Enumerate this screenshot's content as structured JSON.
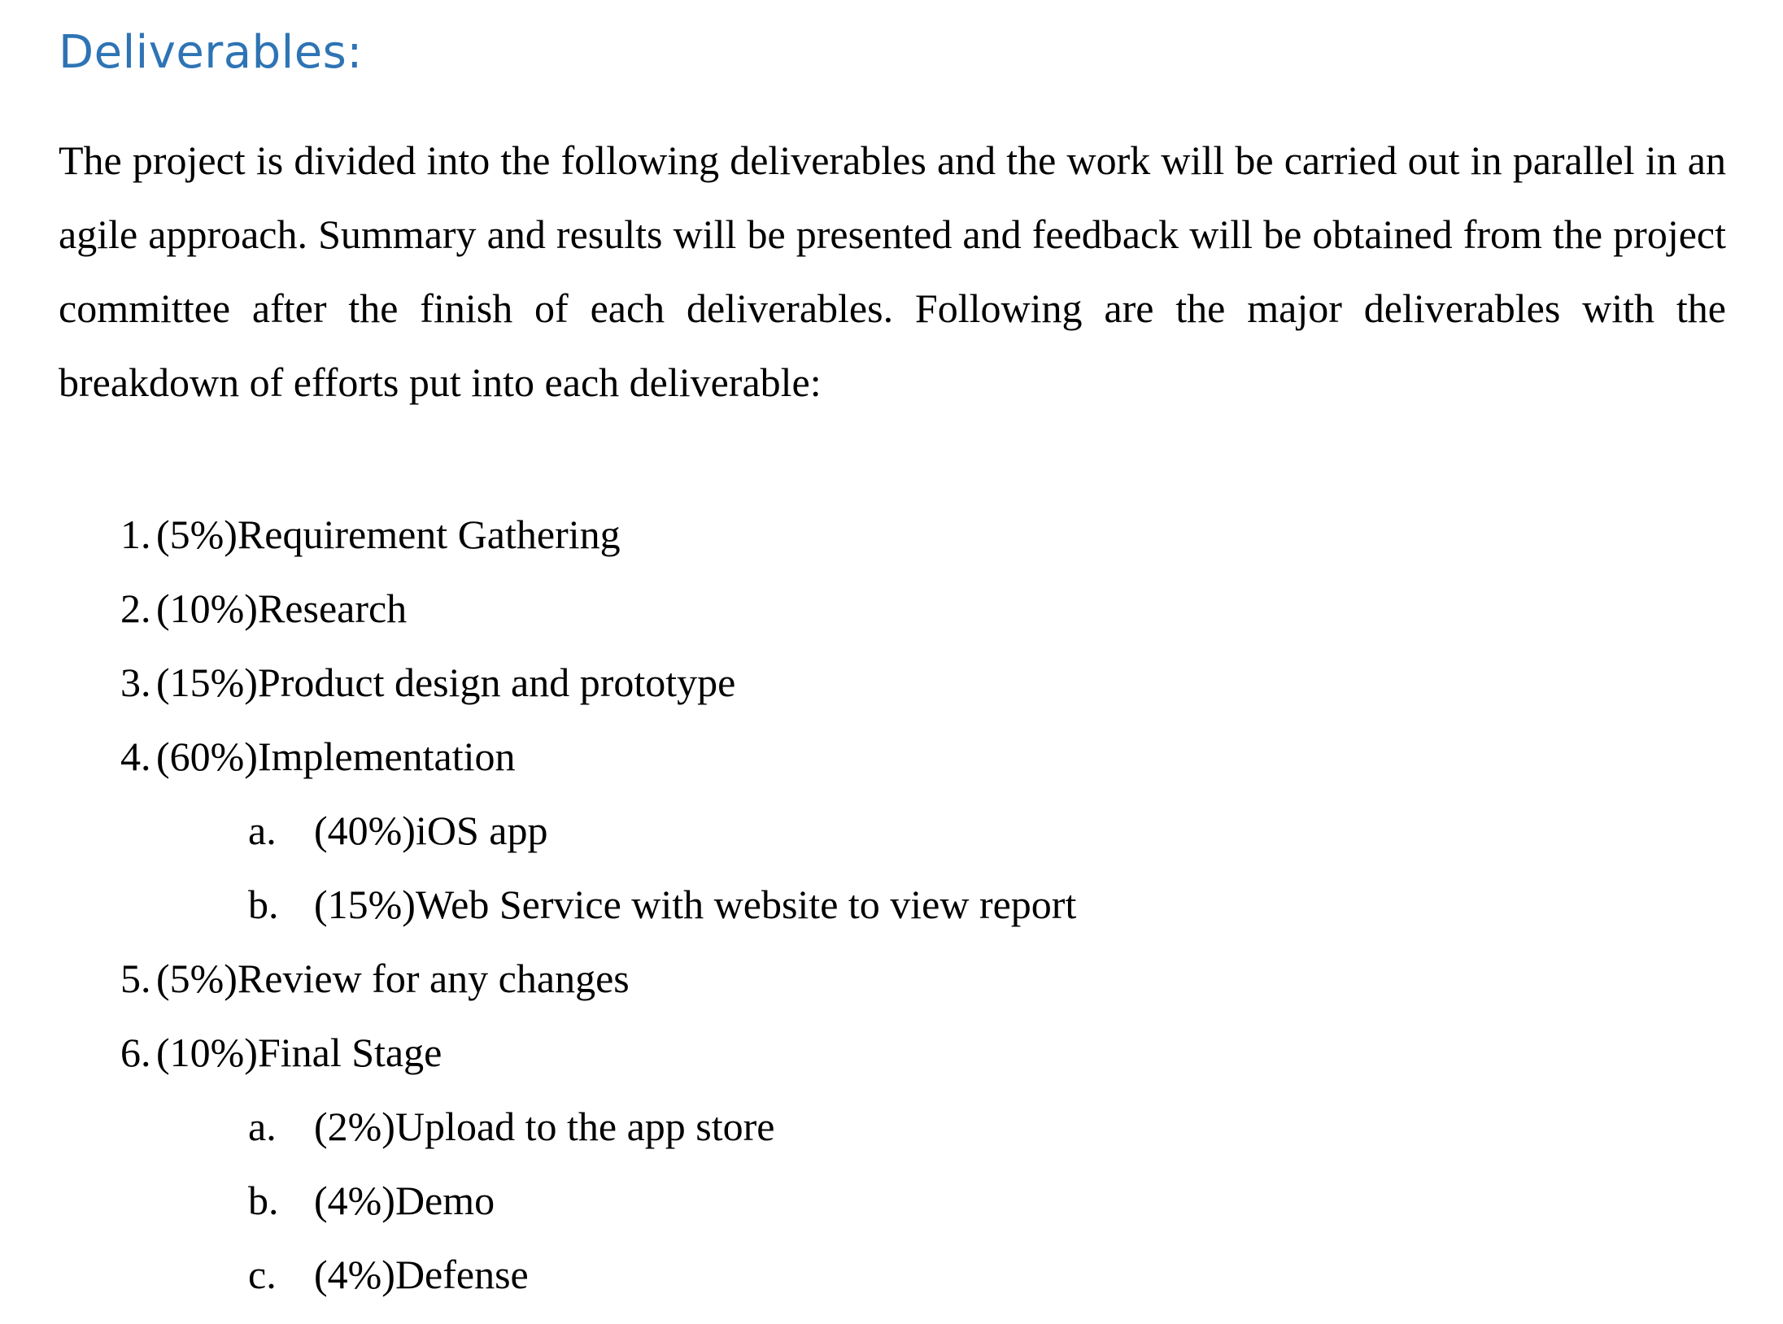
{
  "document": {
    "heading": "Deliverables:",
    "intro": "The project is divided into the following deliverables and the work will be carried out in parallel in an agile approach. Summary and results will be presented and feedback will be obtained from the project committee after the finish of each deliverables. Following are the major deliverables with the breakdown of efforts put into each deliverable:",
    "items": [
      {
        "marker": "1.",
        "text": "(5%)Requirement Gathering"
      },
      {
        "marker": "2.",
        "text": "(10%)Research"
      },
      {
        "marker": "3.",
        "text": "(15%)Product design and prototype"
      },
      {
        "marker": "4.",
        "text": "(60%)Implementation"
      },
      {
        "marker": "a.",
        "text": "(40%)iOS app"
      },
      {
        "marker": "b.",
        "text": "(15%)Web Service with website to view report"
      },
      {
        "marker": "5.",
        "text": "(5%)Review for any changes"
      },
      {
        "marker": "6.",
        "text": "(10%)Final Stage"
      },
      {
        "marker": "a.",
        "text": "(2%)Upload to the app store"
      },
      {
        "marker": "b.",
        "text": "(4%)Demo"
      },
      {
        "marker": "c.",
        "text": "(4%)Defense"
      }
    ]
  },
  "colors": {
    "heading": "#2e74b5",
    "text": "#000000",
    "background": "#ffffff"
  }
}
